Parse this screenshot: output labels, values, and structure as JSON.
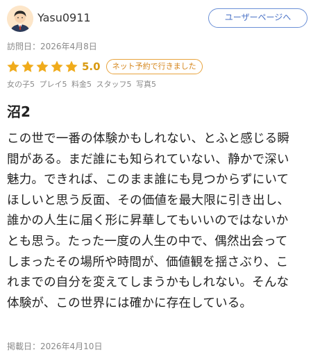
{
  "user": {
    "name": "Yasu0911",
    "avatar_icon": "user-avatar-icon",
    "profile_button_label": "ユーザーページへ"
  },
  "visit": {
    "label": "訪問日：2026年4月8日"
  },
  "rating": {
    "stars": 5,
    "max_stars": 5,
    "score": "5.0",
    "star_color": "#f0ab1b",
    "badge": "ネット予約で行きました"
  },
  "sub_ratings": [
    {
      "text": "女の子5"
    },
    {
      "text": "プレイ5"
    },
    {
      "text": "料金5"
    },
    {
      "text": "スタッフ5"
    },
    {
      "text": "写真5"
    }
  ],
  "review": {
    "title": "沼2",
    "lines": [
      "この世で一番の体験かもしれない、とふと感じる瞬",
      "間がある。まだ誰にも知られていない、静かで深い",
      "魅力。できれば、このまま誰にも見つからずにいて",
      "ほしいと思う反面、その価値を最大限に引き出し、",
      "誰かの人生に届く形に昇華してもいいのではないか",
      "とも思う。たった一度の人生の中で、偶然出会って",
      "しまったその場所や時間が、価値観を揺さぶり、こ",
      "れまでの自分を変えてしまうかもしれない。そんな",
      "体験が、この世界には確かに存在している。"
    ]
  },
  "posted": {
    "label": "掲載日：2026年4月10日"
  },
  "colors": {
    "accent_blue": "#4a72c6",
    "accent_orange": "#d5861c",
    "muted_text": "#8a8a8a"
  }
}
